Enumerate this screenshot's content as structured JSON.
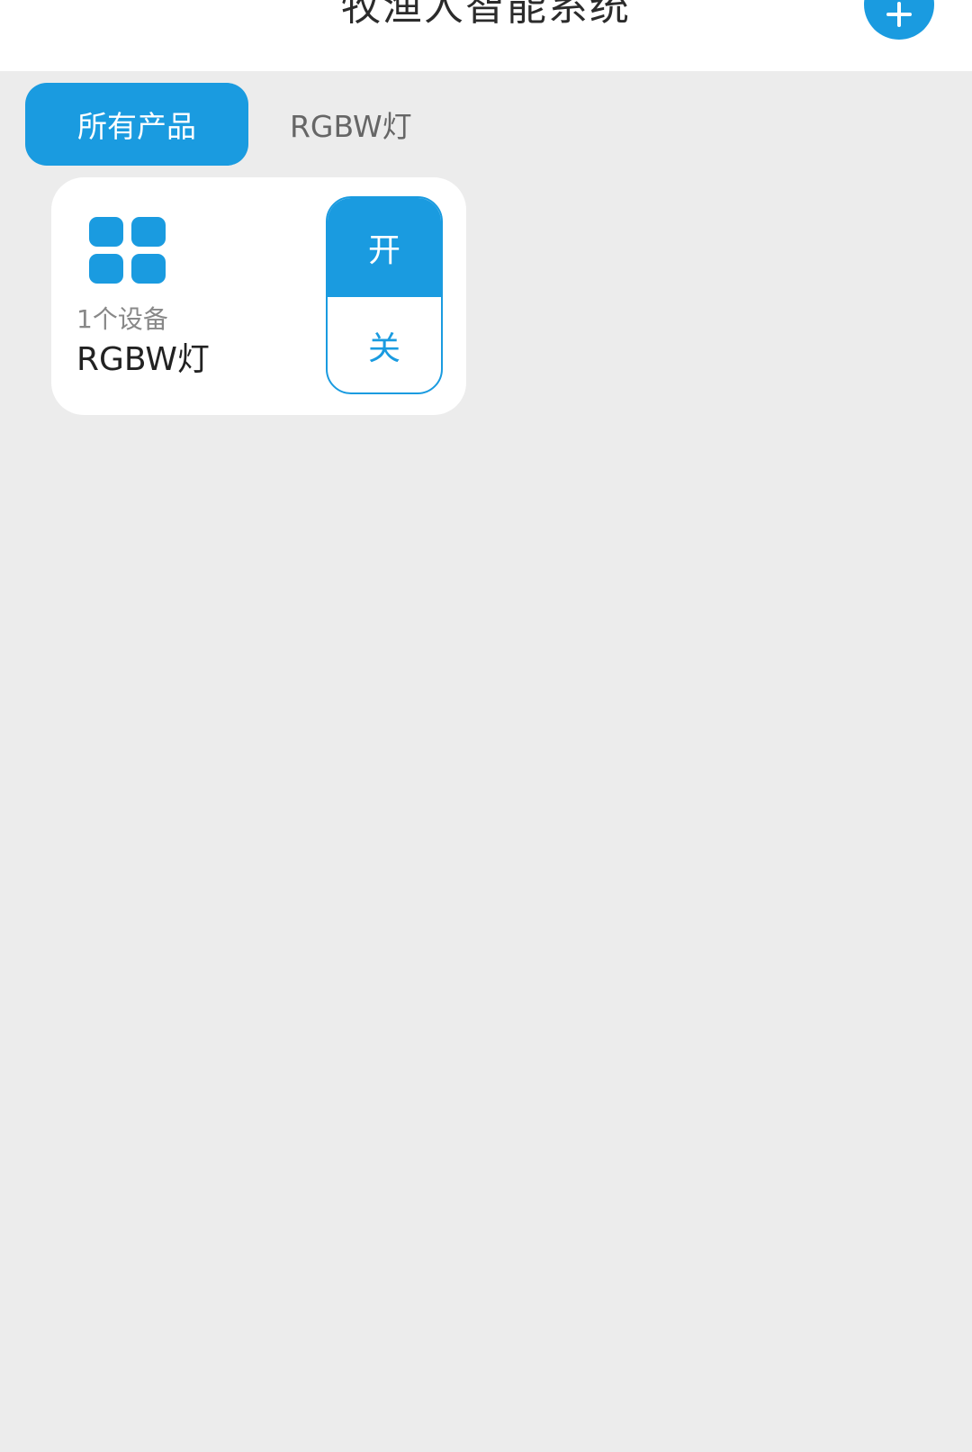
{
  "header": {
    "title": "牧渔人智能系统",
    "add_button_icon": "plus-icon"
  },
  "tabs": [
    {
      "label": "所有产品",
      "active": true
    },
    {
      "label": "RGBW灯",
      "active": false
    }
  ],
  "product_card": {
    "icon": "grid-icon",
    "device_count": "1个设备",
    "name": "RGBW灯",
    "switch": {
      "on_label": "开",
      "off_label": "关"
    }
  },
  "colors": {
    "accent": "#1a9be0",
    "background": "#ececec",
    "card": "#ffffff"
  }
}
